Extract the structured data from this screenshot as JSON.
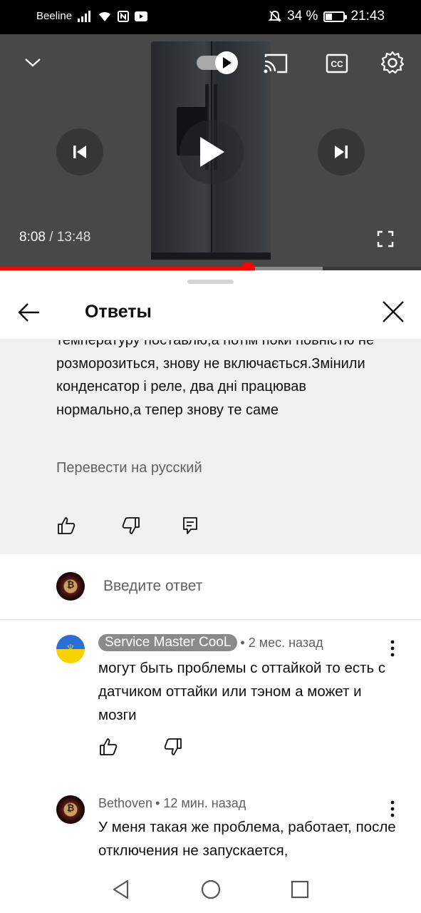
{
  "status_bar": {
    "carrier": "Beeline",
    "battery": "34 %",
    "battery_level": 0.34,
    "time": "21:43"
  },
  "player": {
    "current_time": "8:08",
    "separator": "/",
    "duration": "13:48",
    "progress": 0.588,
    "buffered": 0.767,
    "icons": [
      "chevron-down-icon",
      "autoplay-toggle",
      "cast-icon",
      "cc-icon",
      "settings-icon",
      "previous-icon",
      "play-icon",
      "next-icon",
      "fullscreen-icon"
    ]
  },
  "sheet": {
    "title": "Ответы",
    "parent_comment": {
      "text": "температуру поставлю,а потім поки повністю не розморозиться, знову не включається.Змінили конденсатор і реле, два дні працював нормально,а тепер знову те саме",
      "translate": "Перевести на русский"
    },
    "reply_placeholder": "Введите ответ",
    "comments": [
      {
        "author": "Service Master CooL",
        "time": "• 2 мес. назад",
        "text": "могут быть проблемы с оттайкой  то есть с датчиком оттайки  или тэном а может и мозги"
      },
      {
        "author": "Bethoven",
        "time": "• 12 мин. назад",
        "text": "У меня такая же проблема, работает, после отключения не запускается,"
      }
    ]
  },
  "colors": {
    "progress_red": "#ff0000",
    "parent_bg": "#f0f0f0",
    "meta_gray": "#606060"
  }
}
